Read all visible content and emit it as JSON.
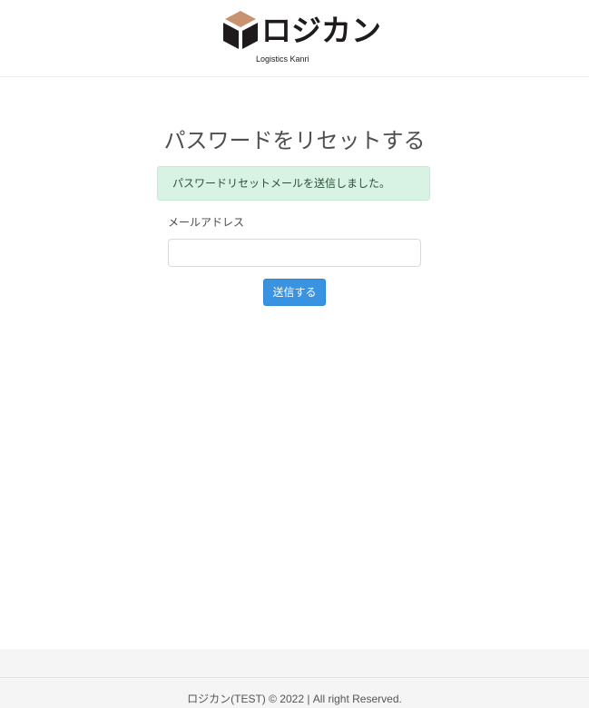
{
  "header": {
    "logo_text": "ロジカン",
    "logo_subtitle": "Logistics Kanri",
    "logo_colors": {
      "cube_top": "#c8916f",
      "cube_side": "#1f1b1c"
    }
  },
  "main": {
    "title": "パスワードをリセットする",
    "alert": {
      "message": "パスワードリセットメールを送信しました。",
      "background": "#d8f3e3"
    },
    "form": {
      "email_label": "メールアドレス",
      "email_value": "",
      "email_placeholder": "",
      "submit_label": "送信する",
      "submit_color": "#3a93e1"
    }
  },
  "footer": {
    "text": "ロジカン(TEST) © 2022 | All right Reserved."
  }
}
